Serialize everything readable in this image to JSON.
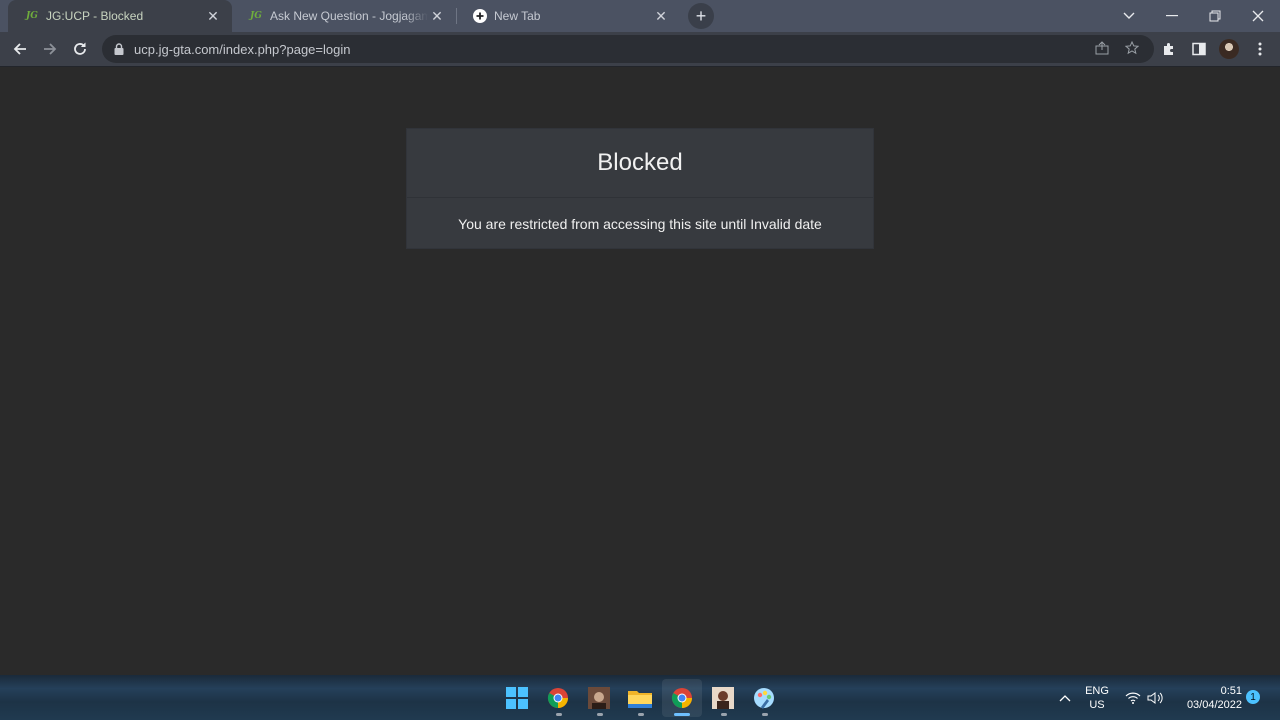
{
  "browser": {
    "tabs": [
      {
        "favicon": "JG",
        "title": "JG:UCP - Blocked",
        "active": true
      },
      {
        "favicon": "JG",
        "title": "Ask New Question - Jogjagamers",
        "active": false
      },
      {
        "favicon": "new-tab-icon",
        "title": "New Tab",
        "active": false
      }
    ],
    "url": "ucp.jg-gta.com/index.php?page=login"
  },
  "page": {
    "title": "Blocked",
    "message": "You are restricted from accessing this site until Invalid date"
  },
  "taskbar": {
    "apps": [
      "windows-start-icon",
      "chrome-icon",
      "profile-app-icon",
      "file-explorer-icon",
      "chrome-active-icon",
      "profile-app-2-icon",
      "paint-icon"
    ],
    "language": "ENG",
    "region": "US",
    "time": "0:51",
    "date": "03/04/2022",
    "notifications": "1"
  },
  "colors": {
    "page_bg": "#2a2a2a",
    "card_bg": "#373a3f",
    "tabstrip_bg": "#4b5262",
    "toolbar_bg": "#3c4049"
  }
}
